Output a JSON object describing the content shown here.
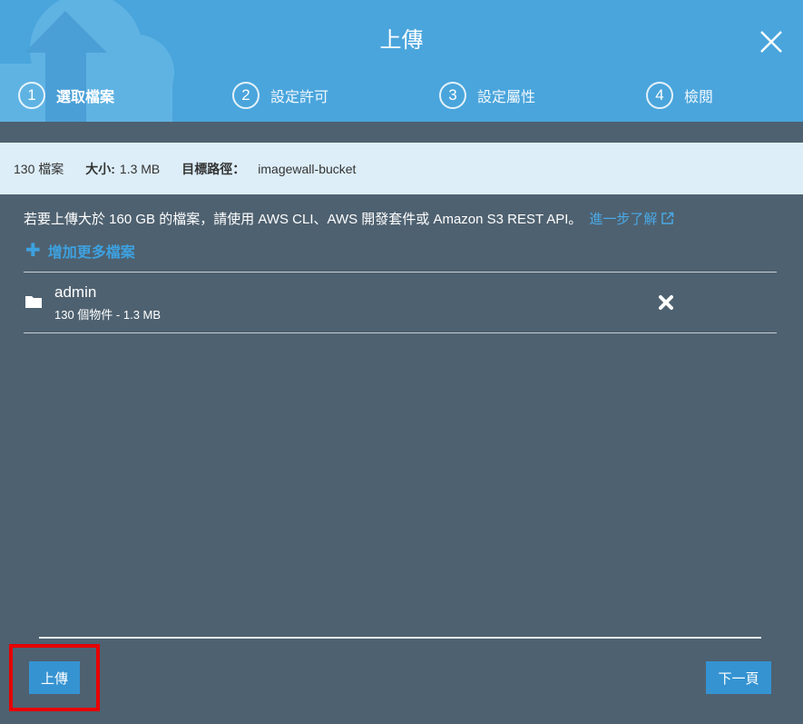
{
  "dialog": {
    "title": "上傳"
  },
  "steps": [
    {
      "number": "1",
      "label": "選取檔案"
    },
    {
      "number": "2",
      "label": "設定許可"
    },
    {
      "number": "3",
      "label": "設定屬性"
    },
    {
      "number": "4",
      "label": "檢閱"
    }
  ],
  "summary": {
    "count": "130 檔案",
    "size_label": "大小:",
    "size_value": "1.3 MB",
    "dest_label": "目標路徑：",
    "dest_value": "imagewall-bucket"
  },
  "notice": {
    "text": "若要上傳大於 160 GB 的檔案，請使用 AWS CLI、AWS 開發套件或 Amazon S3 REST API。",
    "link": "進一步了解"
  },
  "add_more": {
    "label": "增加更多檔案"
  },
  "files": [
    {
      "name": "admin",
      "meta": "130 個物件 - 1.3 MB"
    }
  ],
  "footer": {
    "upload_label": "上傳",
    "next_label": "下一頁"
  },
  "colors": {
    "header": "#4aa5dc",
    "body": "#4e6170",
    "summary": "#ddeef9",
    "button": "#3593d2",
    "link": "#4aa9e6",
    "highlight": "#e60000"
  }
}
